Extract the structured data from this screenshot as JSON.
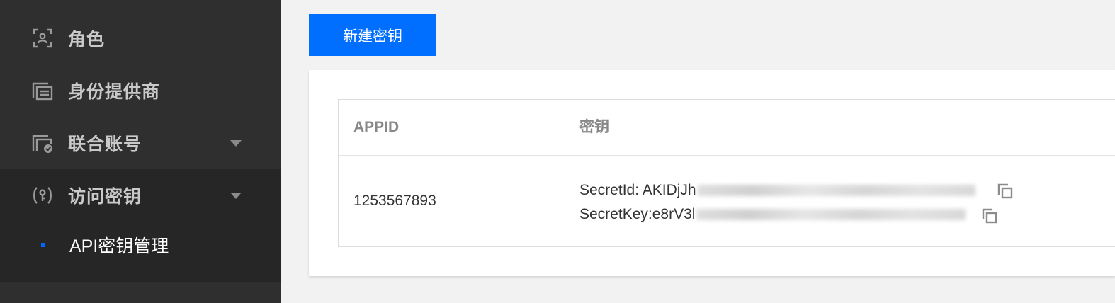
{
  "sidebar": {
    "items": [
      {
        "label": "角色",
        "icon": "role-icon",
        "has_caret": false
      },
      {
        "label": "身份提供商",
        "icon": "identity-provider-icon",
        "has_caret": false
      },
      {
        "label": "联合账号",
        "icon": "federated-account-icon",
        "has_caret": true
      },
      {
        "label": "访问密钥",
        "icon": "access-key-icon",
        "has_caret": true
      }
    ],
    "subitems": [
      {
        "label": "API密钥管理"
      }
    ]
  },
  "toolbar": {
    "create_key_label": "新建密钥"
  },
  "table": {
    "columns": [
      "APPID",
      "密钥"
    ],
    "rows": [
      {
        "appid": "1253567893",
        "secret_id_prefix": "SecretId: AKIDjJh",
        "secret_key_prefix": "SecretKey:e8rV3l"
      }
    ]
  },
  "colors": {
    "sidebar_bg": "#2f2f2f",
    "sidebar_active_bg": "#262626",
    "accent": "#006eff",
    "page_bg": "#f2f2f2"
  }
}
